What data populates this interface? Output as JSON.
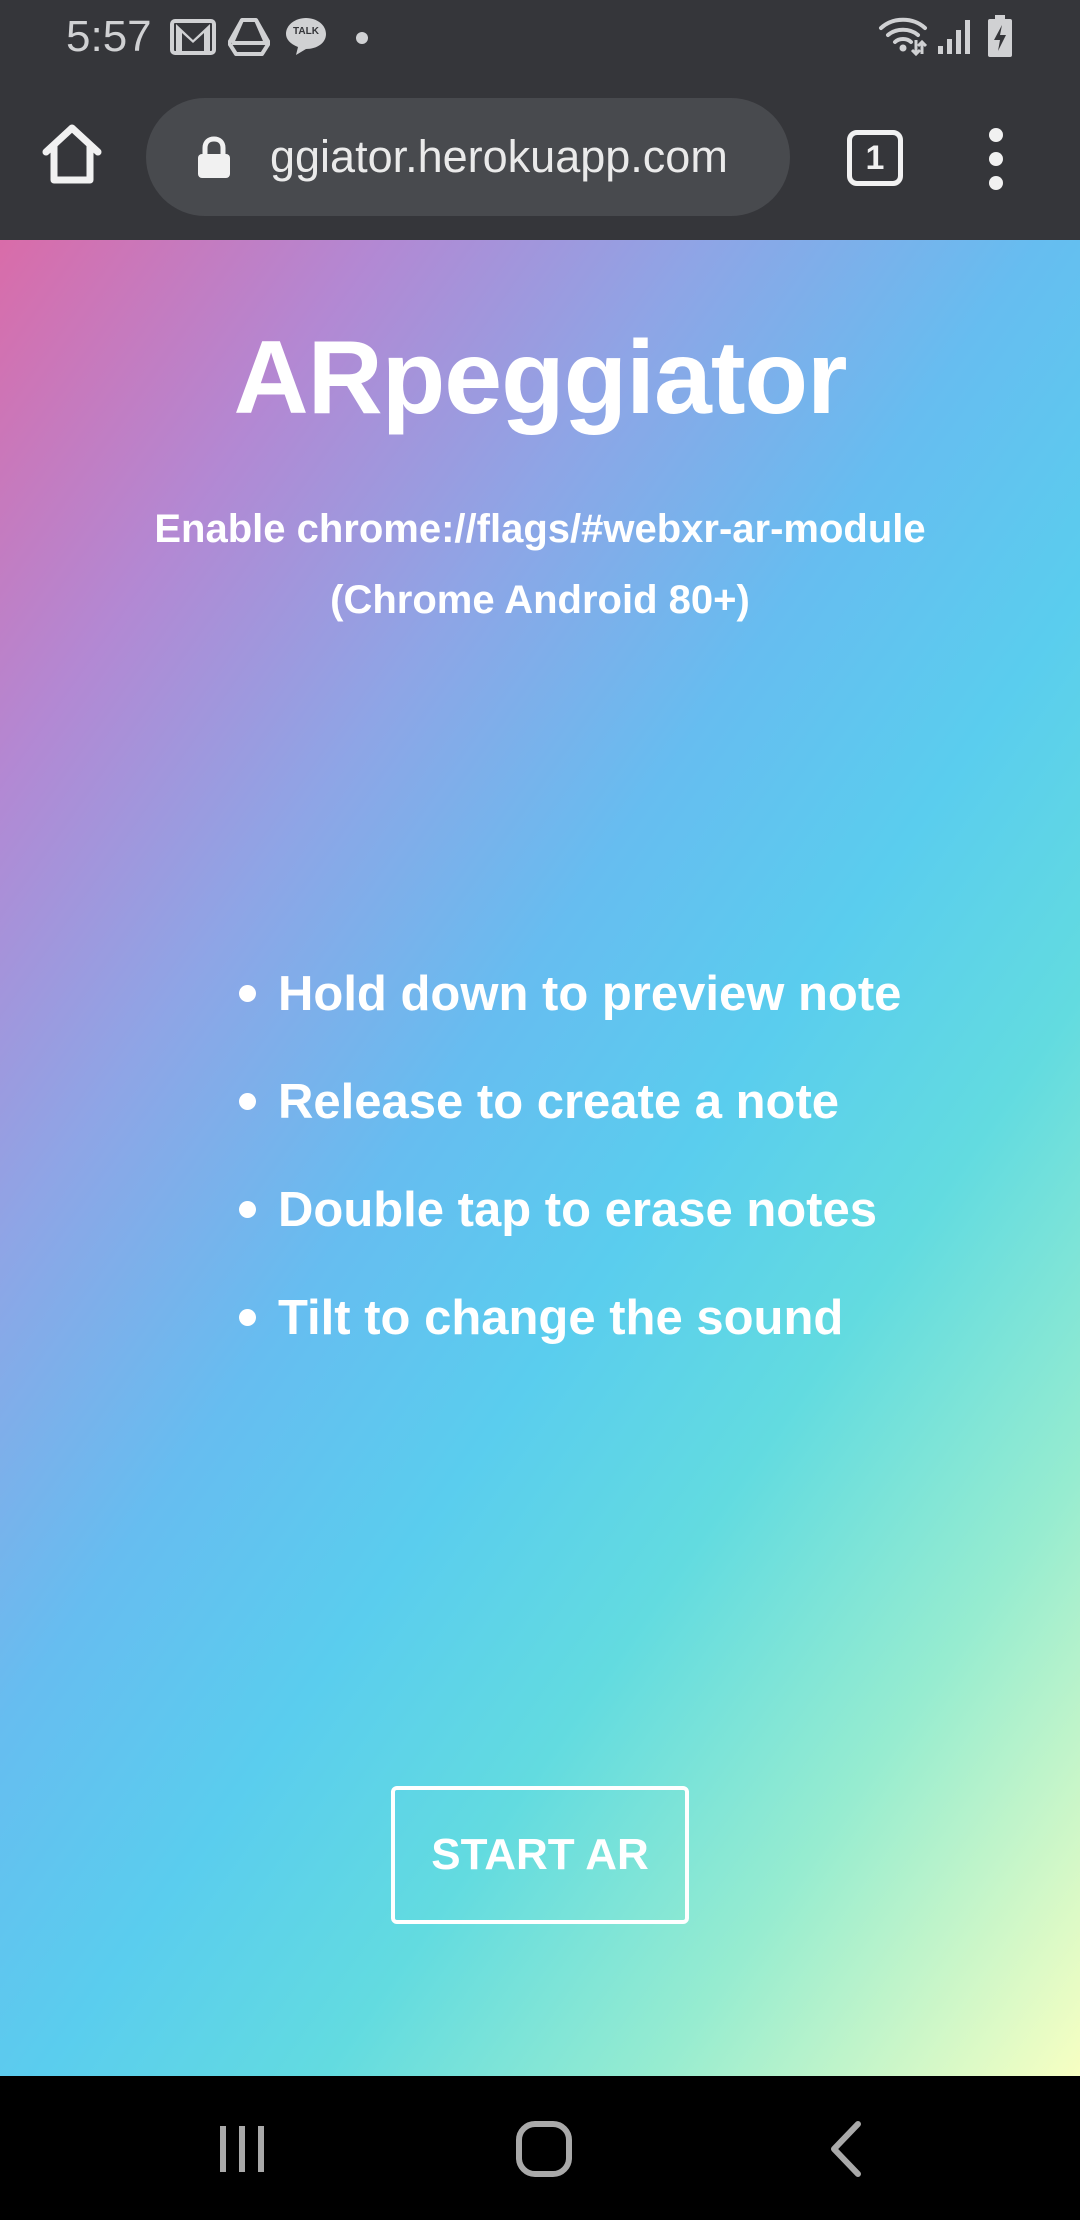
{
  "status_bar": {
    "time": "5:57",
    "left_icons": [
      "gmail-icon",
      "drive-icon",
      "talk-icon",
      "dot-icon"
    ],
    "talk_badge": "TALK",
    "right_icons": [
      "wifi-icon",
      "signal-icon",
      "battery-charging-icon"
    ]
  },
  "toolbar": {
    "url": "ggiator.herokuapp.com",
    "tab_count": "1",
    "icons": [
      "home-icon",
      "lock-icon",
      "more-vert-icon"
    ]
  },
  "page": {
    "title": "ARpeggiator",
    "subtitle_line1": "Enable chrome://flags/#webxr-ar-module",
    "subtitle_line2": "(Chrome Android 80+)",
    "instructions": [
      "Hold down to preview note",
      "Release to create a note",
      "Double tap to erase notes",
      "Tilt to change the sound"
    ],
    "start_button_label": "START AR",
    "gradient_colors": [
      "#d96ca9",
      "#b388d3",
      "#8ea5e6",
      "#66bdf0",
      "#5acdee",
      "#62dbe0",
      "#96ecd0",
      "#f7ffc2"
    ]
  },
  "nav_bar": {
    "buttons": [
      "recents-icon",
      "home-nav-icon",
      "back-icon"
    ]
  },
  "colors": {
    "chrome_bar": "#35363a",
    "omnibox": "#484a4e",
    "text_on_page": "#ffffff"
  }
}
